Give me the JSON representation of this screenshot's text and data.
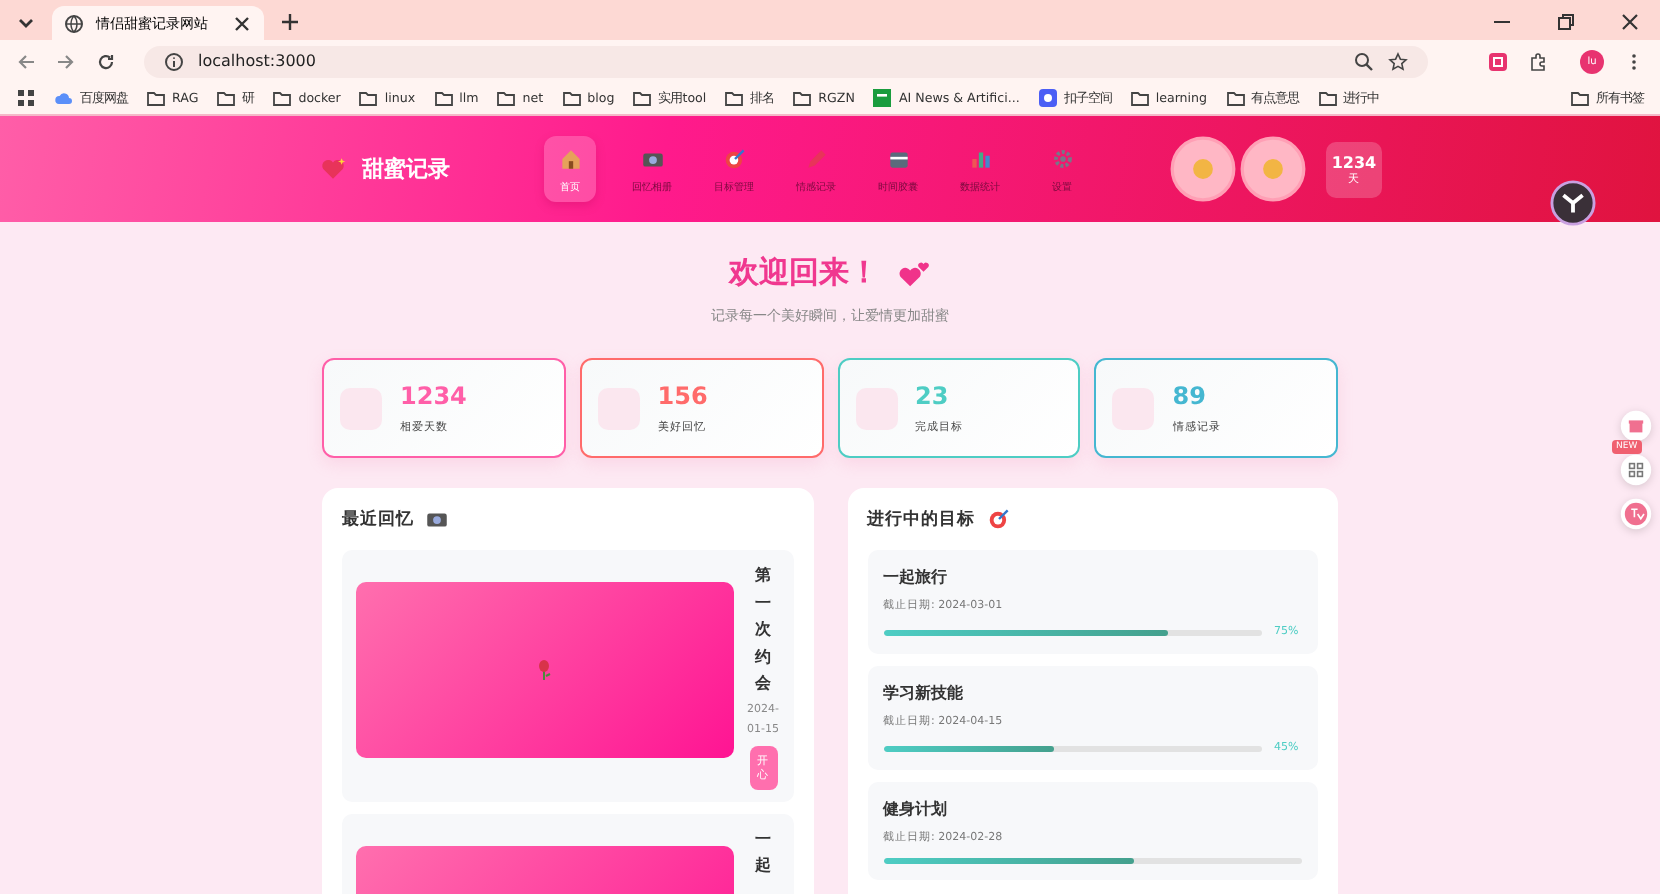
{
  "browser": {
    "tab_title": "情侣甜蜜记录网站",
    "url": "localhost:3000",
    "profile_initial": "lu",
    "bookmarks": [
      {
        "label": "百度网盘",
        "kind": "cloud"
      },
      {
        "label": "RAG",
        "kind": "folder"
      },
      {
        "label": "研",
        "kind": "folder"
      },
      {
        "label": "docker",
        "kind": "folder"
      },
      {
        "label": "linux",
        "kind": "folder"
      },
      {
        "label": "llm",
        "kind": "folder"
      },
      {
        "label": "net",
        "kind": "folder"
      },
      {
        "label": "blog",
        "kind": "folder"
      },
      {
        "label": "实用tool",
        "kind": "folder"
      },
      {
        "label": "排名",
        "kind": "folder"
      },
      {
        "label": "RGZN",
        "kind": "folder"
      },
      {
        "label": "AI News & Artifici...",
        "kind": "site"
      },
      {
        "label": "扣子空间",
        "kind": "app"
      },
      {
        "label": "learning",
        "kind": "folder"
      },
      {
        "label": "有点意思",
        "kind": "folder"
      },
      {
        "label": "进行中",
        "kind": "folder"
      }
    ],
    "all_bookmarks": "所有书签"
  },
  "header": {
    "brand": "甜蜜记录",
    "nav": [
      {
        "label": "首页",
        "selected": true,
        "kind": "house"
      },
      {
        "label": "回忆相册",
        "selected": false,
        "kind": "camera"
      },
      {
        "label": "目标管理",
        "selected": false,
        "kind": "target"
      },
      {
        "label": "情感记录",
        "selected": false,
        "kind": "pen"
      },
      {
        "label": "时间胶囊",
        "selected": false,
        "kind": "box"
      },
      {
        "label": "数据统计",
        "selected": false,
        "kind": "chart"
      },
      {
        "label": "设置",
        "selected": false,
        "kind": "gear"
      }
    ],
    "days_count": "1234",
    "days_unit": "天"
  },
  "welcome": {
    "title": "欢迎回来！",
    "subtitle": "记录每一个美好瞬间，让爱情更加甜蜜"
  },
  "stats": [
    {
      "value": "1234",
      "label": "相爱天数",
      "color": "#ff5fa8"
    },
    {
      "value": "156",
      "label": "美好回忆",
      "color": "#ff6b6b"
    },
    {
      "value": "23",
      "label": "完成目标",
      "color": "#4ecdc4"
    },
    {
      "value": "89",
      "label": "情感记录",
      "color": "#45b7d1"
    }
  ],
  "memories": {
    "title": "最近回忆",
    "items": [
      {
        "title": "第一次约会",
        "date": "2024-01-15",
        "mood": "开心"
      },
      {
        "title": "一起"
      }
    ]
  },
  "goals": {
    "title": "进行中的目标",
    "items": [
      {
        "name": "一起旅行",
        "deadline": "截止日期: 2024-03-01",
        "level": 0.75,
        "percent": "75%"
      },
      {
        "name": "学习新技能",
        "deadline": "截止日期: 2024-04-15",
        "level": 0.45,
        "percent": "45%"
      },
      {
        "name": "健身计划",
        "deadline": "截止日期: 2024-02-28",
        "level": 0.6
      }
    ]
  },
  "float_badge": "NEW"
}
